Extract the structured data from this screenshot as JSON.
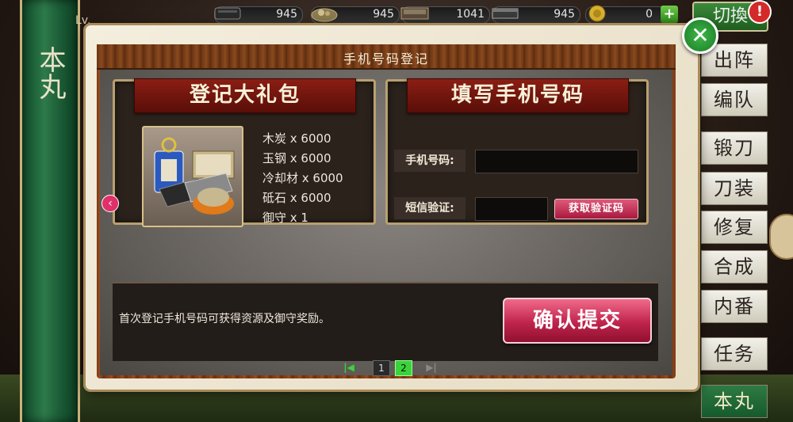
{
  "header": {
    "level_label": "Lv.",
    "resources": [
      {
        "icon": "charcoal-icon",
        "value": "945"
      },
      {
        "icon": "steel-icon",
        "value": "945"
      },
      {
        "icon": "coolant-icon",
        "value": "1041"
      },
      {
        "icon": "whetstone-icon",
        "value": "945"
      },
      {
        "icon": "koban-coin-icon",
        "value": "0"
      }
    ],
    "switch_label": "切換",
    "alert": "!"
  },
  "left_banner": {
    "text": "本丸"
  },
  "menu": {
    "items": [
      "出阵",
      "编队",
      "锻刀",
      "刀装",
      "修复",
      "合成",
      "内番",
      "任务",
      "本丸"
    ]
  },
  "modal": {
    "title": "手机号码登记",
    "gift_panel": {
      "heading": "登记大礼包",
      "rewards": [
        "木炭 x 6000",
        "玉钢 x 6000",
        "冷却材 x 6000",
        "砥石 x 6000",
        "御守 x 1"
      ]
    },
    "phone_panel": {
      "heading": "填写手机号码",
      "phone_label": "手机号码:",
      "sms_label": "短信验证:",
      "get_code_label": "获取验证码"
    },
    "note": "首次登记手机号码可获得资源及御守奖励。",
    "confirm_label": "确认提交",
    "pager": {
      "first": "|◀",
      "pages": [
        "1",
        "2"
      ],
      "current": "2",
      "last": "▶|"
    }
  },
  "colors": {
    "accent_red": "#8a1e14",
    "confirm_pink": "#c0244c",
    "close_green": "#2e9a3a",
    "page_current": "#3ad43a"
  }
}
